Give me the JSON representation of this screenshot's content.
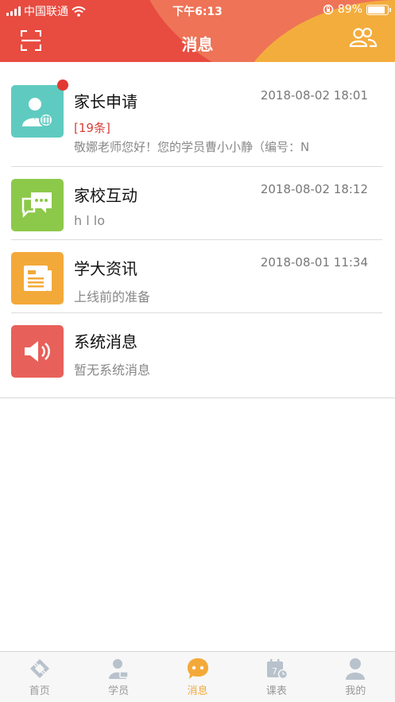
{
  "status_bar": {
    "carrier": "中国联通",
    "time": "下午6:13",
    "battery": "89%",
    "battery_level": 0.89
  },
  "header": {
    "title": "消息",
    "scan_icon": "scan-icon",
    "contacts_icon": "contacts-icon"
  },
  "messages": [
    {
      "title": "家长申请",
      "time": "2018-08-02 18:01",
      "count": "[19条]",
      "preview": "敬娜老师您好！您的学员曹小小静（编号：N",
      "icon": "parent-application-icon",
      "color": "#5fcbc0",
      "unread": true
    },
    {
      "title": "家校互动",
      "time": "2018-08-02 18:12",
      "preview": "h l lo",
      "icon": "chat-bubbles-icon",
      "color": "#8cc94a"
    },
    {
      "title": "学大资讯",
      "time": "2018-08-01 11:34",
      "preview": "上线前的准备",
      "icon": "news-icon",
      "color": "#f3a93a"
    },
    {
      "title": "系统消息",
      "time": "",
      "preview": "暂无系统消息",
      "icon": "speaker-icon",
      "color": "#e8605a"
    }
  ],
  "tabs": [
    {
      "label": "首页",
      "icon": "home-icon",
      "active": false
    },
    {
      "label": "学员",
      "icon": "student-icon",
      "active": false
    },
    {
      "label": "消息",
      "icon": "message-icon",
      "active": true
    },
    {
      "label": "课表",
      "icon": "schedule-icon",
      "active": false
    },
    {
      "label": "我的",
      "icon": "profile-icon",
      "active": false
    }
  ],
  "colors": {
    "header_red": "#e84b40",
    "header_orange": "#f3ad3d",
    "active_tab": "#f3a93a",
    "inactive_tab": "#b8c2cc"
  }
}
